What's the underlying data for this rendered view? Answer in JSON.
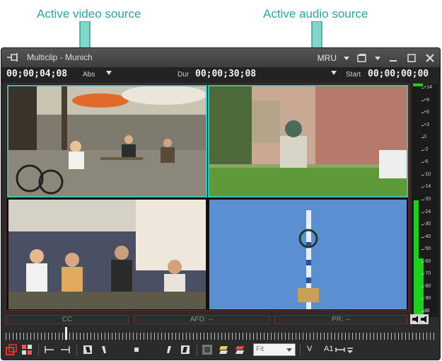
{
  "callouts": {
    "video": "Active video source",
    "audio": "Active audio source"
  },
  "window": {
    "title": "Multiclip - Munich",
    "mru_label": "MRU"
  },
  "timecode_bar": {
    "current_tc": "00;00;04;08",
    "abs_label": "Abs",
    "dur_label": "Dur",
    "dur_tc": "00;00;30;08",
    "start_label": "Start",
    "start_tc": "00;00;00;00"
  },
  "meter": {
    "scale": [
      "+14",
      "+9",
      "+6",
      "+3",
      "0",
      "-2",
      "-6",
      "-10",
      "-14",
      "-20",
      "-24",
      "-30",
      "-40",
      "-50",
      "-60",
      "-70",
      "-80",
      "-90",
      "dB"
    ],
    "level_left": 0.52,
    "level_right": 0.26,
    "colors": {
      "level": "#1fd11f",
      "peak": "#1fd11f"
    }
  },
  "info_bar": {
    "cc": "CC",
    "afd": "AFD: --",
    "pr": "PR: --"
  },
  "toolbar": {
    "fit": "Fit",
    "v_label": "V",
    "a1_label": "A1"
  },
  "colors": {
    "accent": "#2aa39a",
    "active_outline": "#3fbfb2",
    "frame_border": "#6b2a2a"
  }
}
